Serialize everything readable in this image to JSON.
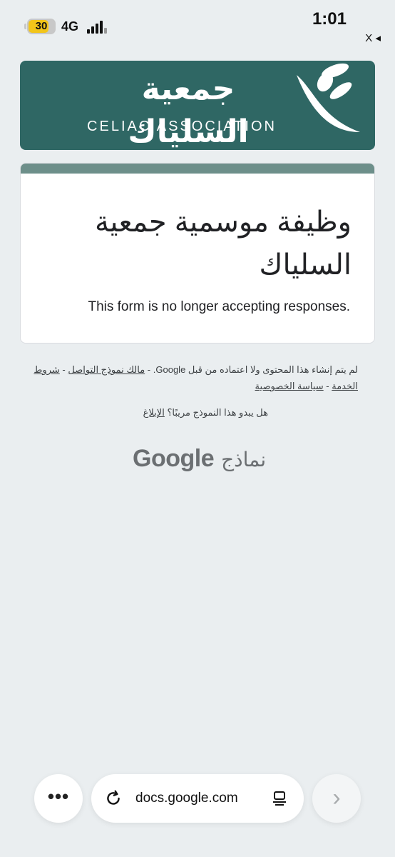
{
  "status_bar": {
    "battery_percent": "30",
    "network": "4G",
    "time": "1:01",
    "close_label": "X ◂"
  },
  "banner": {
    "arabic_name": "جمعية السلياك",
    "english_name": "CELIAC ASSOCIATION",
    "background_color": "#2f6764"
  },
  "form": {
    "title": "وظيفة موسمية جمعية السلياك",
    "message": ".This form is no longer accepting responses",
    "accent_color": "#6d8f8a"
  },
  "footer": {
    "disclaimer_text": "لم يتم إنشاء هذا المحتوى ولا اعتماده من قبل Google.",
    "contact_link": "مالك نموذج التواصل",
    "terms_link": "شروط الخدمة",
    "privacy_link": "سياسة الخصوصية",
    "report_question": "هل يبدو هذا النموذج مريبًا؟",
    "report_link": "الإبلاغ",
    "brand_google": "Google",
    "brand_forms": "نماذج"
  },
  "browser": {
    "more_icon": "more-icon",
    "url": "docs.google.com",
    "forward_icon": "chevron-right-icon"
  }
}
